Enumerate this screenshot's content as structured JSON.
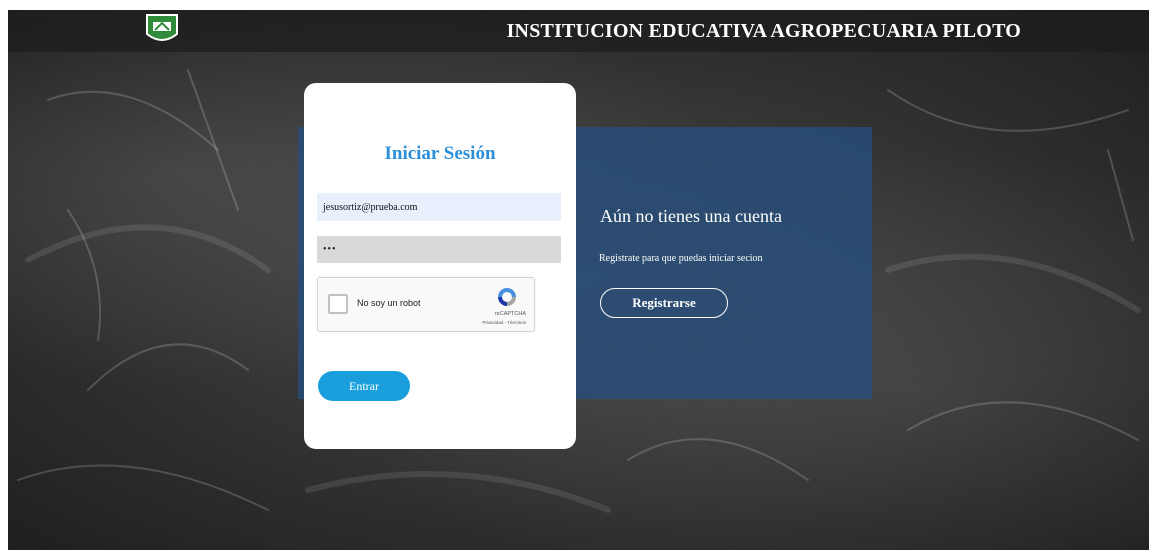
{
  "header": {
    "logo_icon": "school-shield-logo",
    "title": "INSTITUCION EDUCATIVA AGROPECUARIA PILOTO"
  },
  "login": {
    "title": "Iniciar Sesión",
    "email_value": "jesusortiz@prueba.com",
    "password_value": "•••",
    "recaptcha": {
      "label": "No soy un robot",
      "brand": "reCAPTCHA",
      "links": "Privacidad - Términos"
    },
    "submit_label": "Entrar"
  },
  "register": {
    "title": "Aún no tienes una cuenta",
    "text": "Registrate para que puedas iniciar secion",
    "button_label": "Registrarse"
  },
  "colors": {
    "accent_title": "#2d8fd9",
    "login_button": "#1a9fdc",
    "register_panel": "#274e78",
    "email_field": "#e8f0fe"
  }
}
